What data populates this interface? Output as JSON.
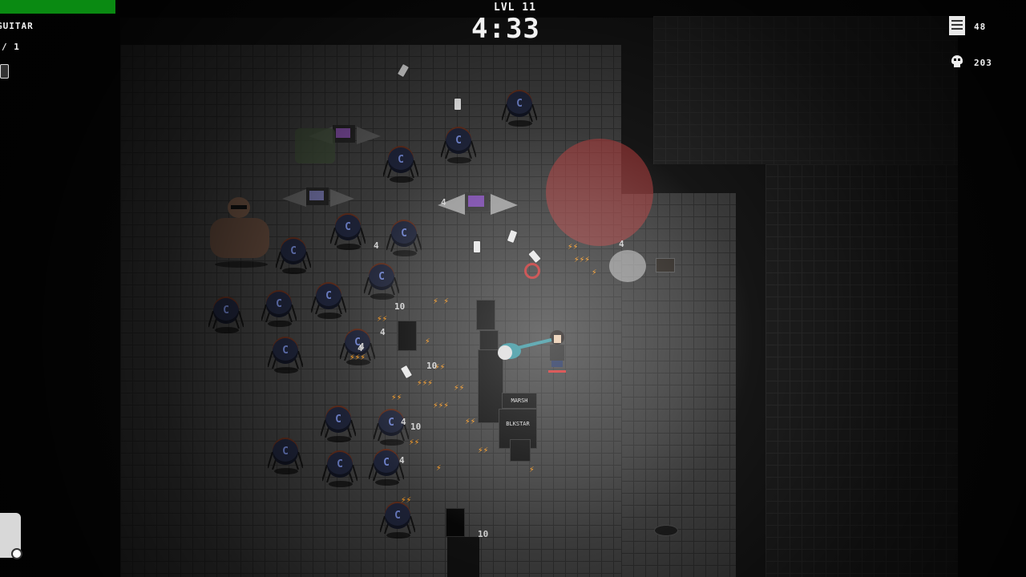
{
  "hud": {
    "level_label": "LVL 11",
    "timer": "4:33",
    "weapon_label": "GUITAR",
    "weapon_count": "/ 1",
    "scroll_count": "48",
    "kill_count": "203"
  },
  "colors": {
    "health_bar": "#0a8a12",
    "danger_zone": "#b03a3a",
    "bolt": "#ff9a1a",
    "spider_body": "#1d2236",
    "guitar": "#2f8f9a"
  },
  "damage_numbers": [
    "4",
    "4",
    "4",
    "4",
    "4",
    "10",
    "10",
    "4",
    "10",
    "4",
    "10",
    "4"
  ],
  "amp_labels": [
    "MARSH",
    "BLKSTAR",
    "MARSH"
  ],
  "icons": {
    "scroll": "scroll-icon",
    "skull": "skull-icon",
    "weapon_slot": "weapon-slot-icon",
    "ability": "ability-slot-icon"
  }
}
